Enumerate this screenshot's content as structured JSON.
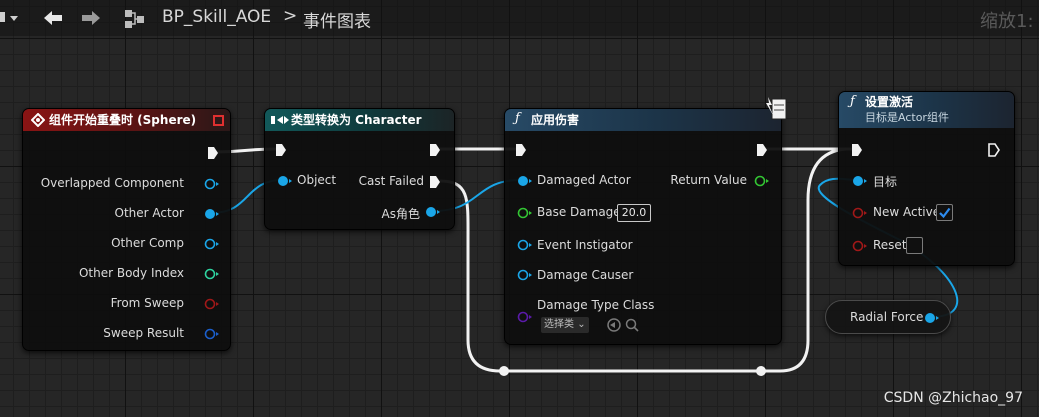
{
  "toolbar": {
    "blueprint_name": "BP_Skill_AOE",
    "separator": ">",
    "graph_name": "事件图表",
    "zoom": "缩放1:"
  },
  "nodes": {
    "overlap": {
      "title": "组件开始重叠时 (Sphere)",
      "pins": [
        "Overlapped Component",
        "Other Actor",
        "Other Comp",
        "Other Body Index",
        "From Sweep",
        "Sweep Result"
      ]
    },
    "cast": {
      "title": "类型转换为 Character",
      "object": "Object",
      "cast_failed": "Cast Failed",
      "as_char": "As角色"
    },
    "apply_damage": {
      "title": "应用伤害",
      "damaged_actor": "Damaged Actor",
      "return_value": "Return Value",
      "base_damage": "Base Damage",
      "base_damage_value": "20.0",
      "event_instigator": "Event Instigator",
      "damage_causer": "Damage Causer",
      "damage_type_class": "Damage Type Class",
      "select_class": "选择类"
    },
    "set_active": {
      "title": "设置激活",
      "subtitle": "目标是Actor组件",
      "target": "目标",
      "new_active": "New Active",
      "new_active_checked": true,
      "reset": "Reset",
      "reset_checked": false
    },
    "radial_force": {
      "label": "Radial Force"
    }
  },
  "watermark": "CSDN @Zhichao_97",
  "colors": {
    "object_pin": "#1aa6e8",
    "float_pin": "#33c633",
    "int_pin": "#2ed3a0",
    "bool_pin": "#a01818",
    "struct_pin": "#1b5fcc",
    "class_pin": "#5a1aa8",
    "event_header": "#8a1414",
    "cast_header": "#12595a",
    "function_header": "#274a66"
  }
}
